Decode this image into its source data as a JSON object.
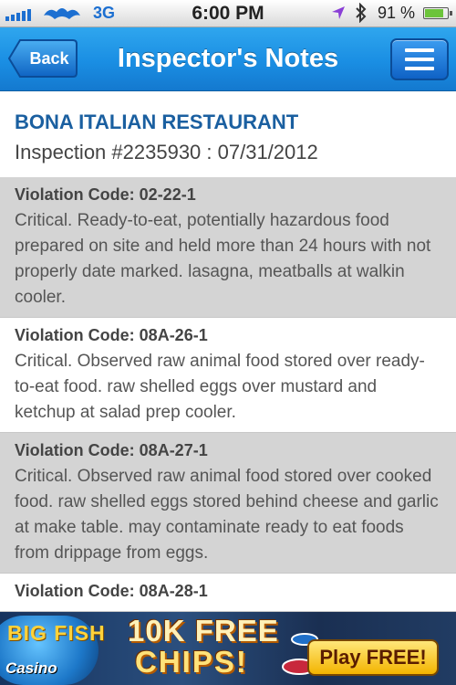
{
  "status_bar": {
    "network": "3G",
    "time": "6:00 PM",
    "battery_percent": "91 %",
    "battery_level": 0.91
  },
  "nav": {
    "back_label": "Back",
    "title": "Inspector's Notes"
  },
  "report": {
    "restaurant_name": "BONA ITALIAN RESTAURANT",
    "inspection_line": "Inspection #2235930  :  07/31/2012",
    "violations": [
      {
        "code_label": "Violation Code: 02-22-1",
        "description": "Critical.  Ready-to-eat, potentially hazardous food prepared on site and held more than 24 hours with not properly date marked. lasagna, meatballs at walkin cooler."
      },
      {
        "code_label": "Violation Code: 08A-26-1",
        "description": "Critical.  Observed raw animal food stored over ready-to-eat food. raw shelled eggs over mustard and ketchup at salad prep cooler."
      },
      {
        "code_label": "Violation Code: 08A-27-1",
        "description": "Critical.  Observed raw animal food stored over cooked food. raw shelled eggs stored behind cheese and garlic at make table. may contaminate ready to eat foods from drippage from eggs."
      },
      {
        "code_label": "Violation Code: 08A-28-1",
        "description": ""
      }
    ]
  },
  "ad": {
    "logo_line1": "BIG FISH",
    "logo_line2": "Casino",
    "headline_line1": "10K FREE",
    "headline_line2": "CHIPS!",
    "cta_label": "Play FREE!"
  }
}
